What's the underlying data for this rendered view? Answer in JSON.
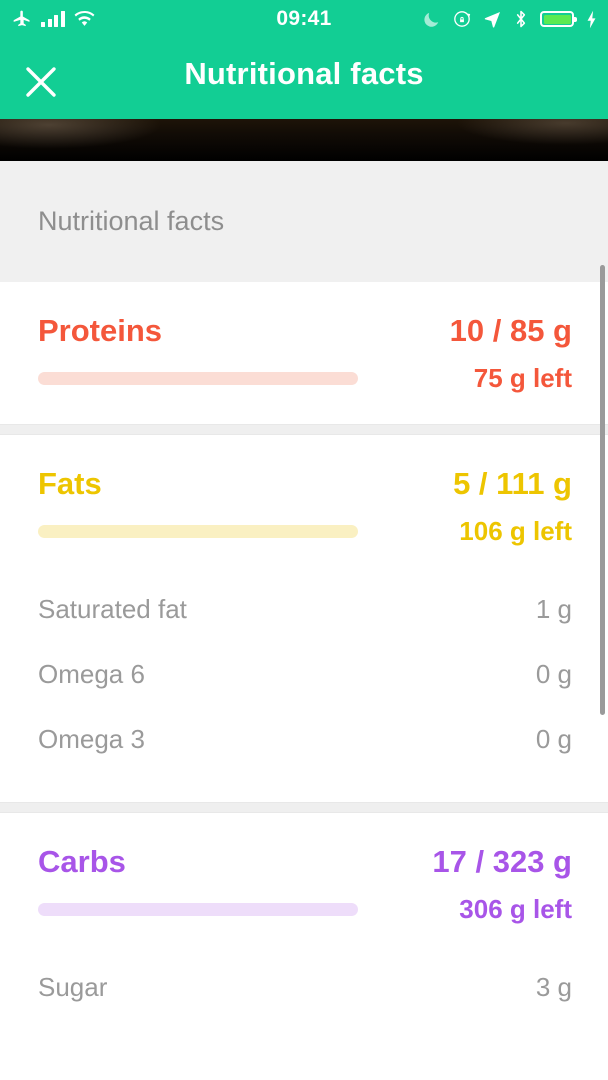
{
  "statusbar": {
    "time": "09:41",
    "left_icons": [
      "airplane-mode-icon",
      "cellular-signal-icon",
      "wifi-icon"
    ],
    "right_icons": [
      "do-not-disturb-moon-icon",
      "rotation-lock-icon",
      "location-arrow-icon",
      "bluetooth-icon",
      "battery-icon",
      "charging-bolt-icon"
    ],
    "battery_color": "#5BEA52"
  },
  "navbar": {
    "title": "Nutritional facts",
    "close_icon": "close-x-icon",
    "background": "#12CE94"
  },
  "section": {
    "header_label": "Nutritional facts"
  },
  "macros": [
    {
      "name": "Proteins",
      "total": "10 / 85 g",
      "left": "75 g left",
      "color": "#F4573B",
      "track_color": "#FBDDD5",
      "progress_percent": 12,
      "sub_items": []
    },
    {
      "name": "Fats",
      "total": "5 / 111 g",
      "left": "106 g left",
      "color": "#EDC500",
      "track_color": "#FAF0C2",
      "progress_percent": 5,
      "sub_items": [
        {
          "label": "Saturated fat",
          "value": "1 g"
        },
        {
          "label": "Omega 6",
          "value": "0 g"
        },
        {
          "label": "Omega 3",
          "value": "0 g"
        }
      ]
    },
    {
      "name": "Carbs",
      "total": "17 / 323 g",
      "left": "306 g left",
      "color": "#A855E8",
      "track_color": "#EEDDFA",
      "progress_percent": 5,
      "sub_items": [
        {
          "label": "Sugar",
          "value": "3 g"
        }
      ]
    }
  ]
}
